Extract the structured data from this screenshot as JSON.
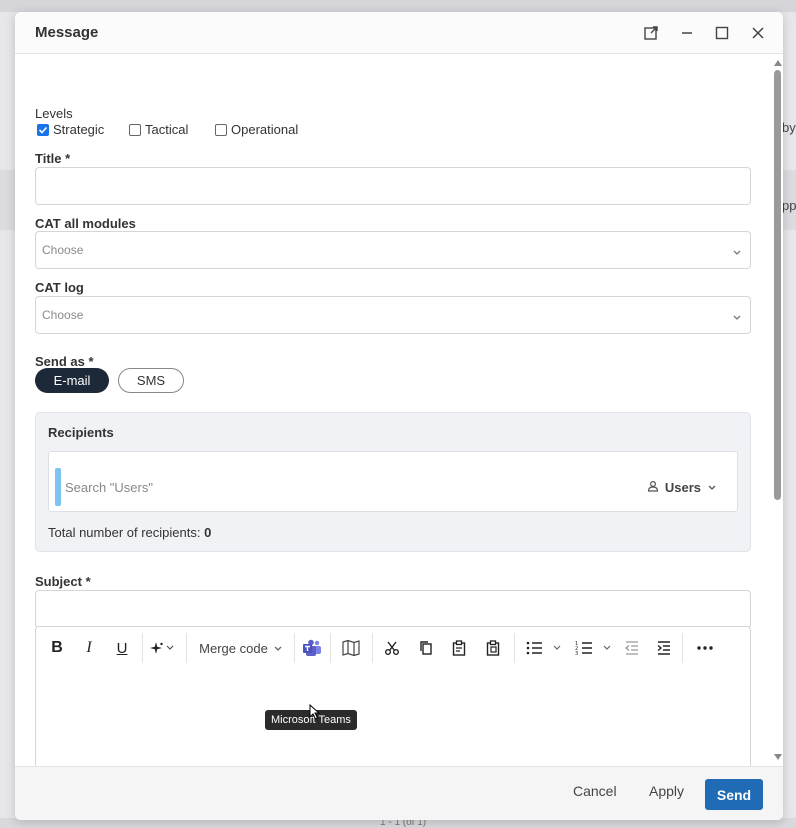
{
  "background": {
    "text_right_1": "by",
    "text_right_2": "pp",
    "footer_text": "1 - 1 (of 1)"
  },
  "modal": {
    "title": "Message",
    "header_icons": [
      "popout-icon",
      "minimize-icon",
      "maximize-icon",
      "close-icon"
    ]
  },
  "levels": {
    "label": "Levels",
    "options": [
      {
        "label": "Strategic",
        "checked": true
      },
      {
        "label": "Tactical",
        "checked": false
      },
      {
        "label": "Operational",
        "checked": false
      }
    ]
  },
  "title_field": {
    "label": "Title",
    "required_mark": "*",
    "value": ""
  },
  "cat_all_modules": {
    "label": "CAT all modules",
    "placeholder": "Choose"
  },
  "cat_log": {
    "label": "CAT log",
    "placeholder": "Choose"
  },
  "send_as": {
    "label": "Send as",
    "required_mark": "*",
    "options": [
      {
        "label": "E-mail",
        "selected": true
      },
      {
        "label": "SMS",
        "selected": false
      }
    ]
  },
  "recipients": {
    "title": "Recipients",
    "search_placeholder": "Search \"Users\"",
    "filter_label": "Users",
    "total_label": "Total number of recipients:",
    "total_value": "0"
  },
  "subject_field": {
    "label": "Subject",
    "required_mark": "*",
    "value": ""
  },
  "editor": {
    "merge_code_label": "Merge code",
    "tooltip": "Microsoft Teams",
    "toolbar_icons": [
      "bold-icon",
      "italic-icon",
      "underline-icon",
      "ai-sparkle-icon",
      "merge-code-dropdown",
      "microsoft-teams-icon",
      "map-icon",
      "cut-icon",
      "copy-icon",
      "paste-icon",
      "paste-special-icon",
      "bullet-list-icon",
      "numbered-list-icon",
      "outdent-icon",
      "indent-icon",
      "more-icon"
    ]
  },
  "footer": {
    "cancel_label": "Cancel",
    "apply_label": "Apply",
    "send_label": "Send"
  },
  "colors": {
    "primary_button": "#1f6bb5",
    "pill_active": "#1d2939",
    "checkbox_checked": "#1a73e8",
    "search_accent": "#7cc3f0",
    "teams_purple": "#5b5fc7"
  }
}
